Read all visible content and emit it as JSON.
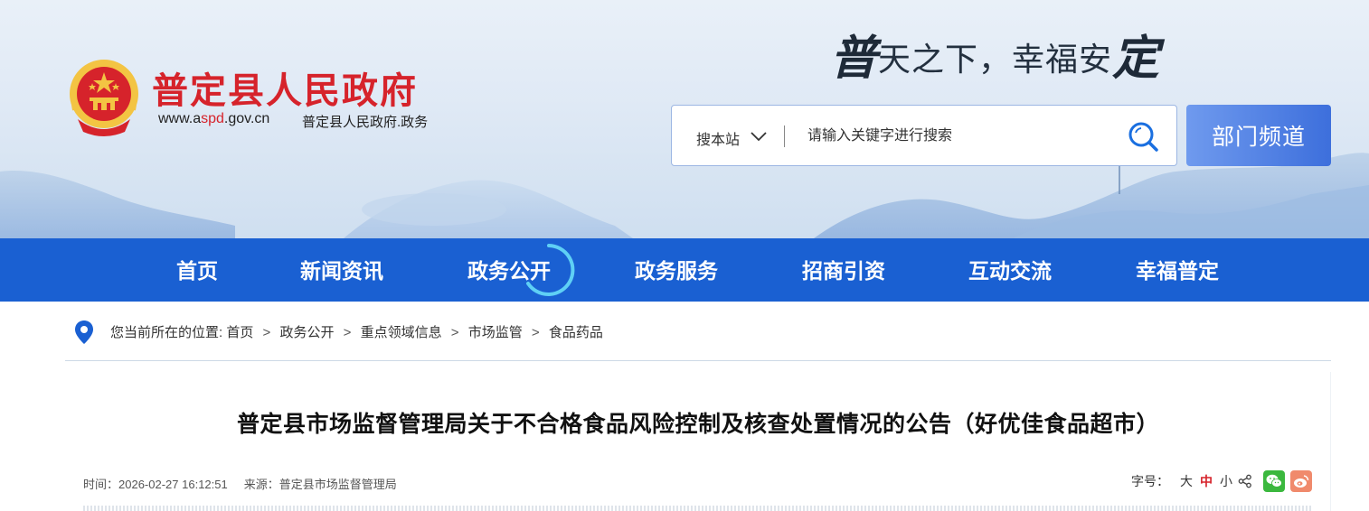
{
  "header": {
    "site_name": "普定县人民政府",
    "url_prefix": "www.a",
    "url_highlight": "spd",
    "url_suffix": ".gov.cn",
    "site_sub": "普定县人民政府.政务",
    "slogan_first": "普",
    "slogan_middle": "天之下，幸福安",
    "slogan_last": "定",
    "emblem_icon": "national-emblem-icon"
  },
  "search": {
    "scope_label": "搜本站",
    "placeholder": "请输入关键字进行搜索",
    "value": ""
  },
  "dept_button": "部门频道",
  "nav": {
    "items": [
      "首页",
      "新闻资讯",
      "政务公开",
      "政务服务",
      "招商引资",
      "互动交流",
      "幸福普定"
    ],
    "active_index": 2
  },
  "breadcrumb": {
    "prefix": "您当前所在的位置:",
    "items": [
      "首页",
      "政务公开",
      "重点领域信息",
      "市场监管",
      "食品药品"
    ],
    "separator": ">"
  },
  "article": {
    "title": "普定县市场监督管理局关于不合格食品风险控制及核查处置情况的公告（好优佳食品超市）",
    "time_label": "时间：",
    "time": "2026-02-27 16:12:51",
    "source_label": "来源：",
    "source": "普定县市场监督管理局",
    "font_size_label": "字号：",
    "font_sizes": [
      "大",
      "中",
      "小"
    ],
    "font_size_active": "中"
  },
  "colors": {
    "brand_red": "#d6232b",
    "nav_blue": "#1a60d2",
    "dept_button": "#4f80e4",
    "wechat": "#3bb83e",
    "weibo": "#f08a6c"
  }
}
